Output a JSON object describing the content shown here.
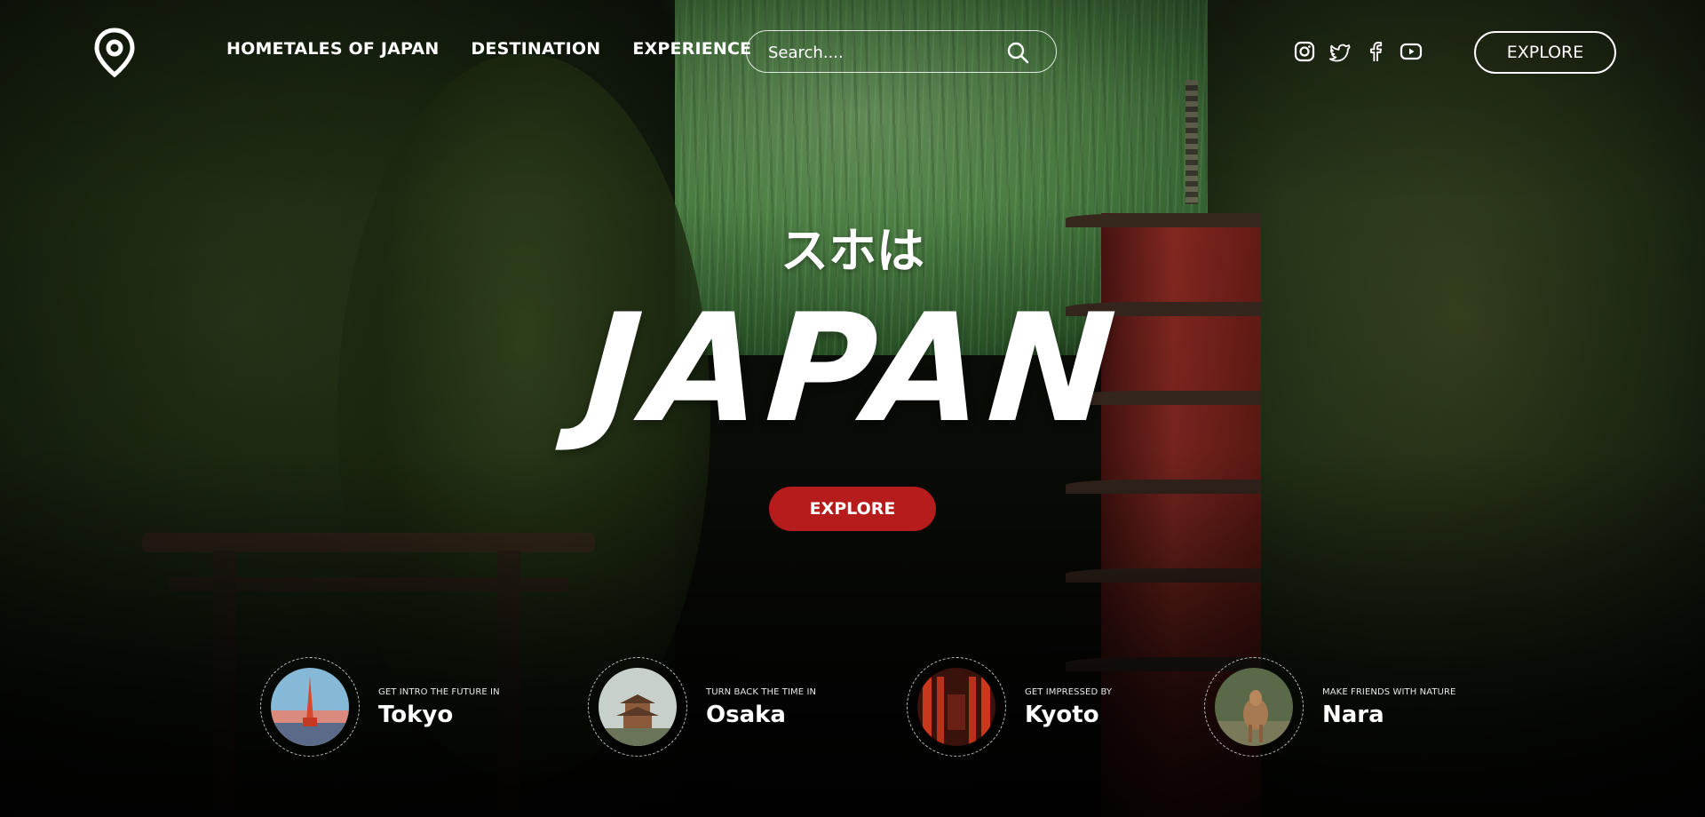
{
  "header": {
    "nav": [
      "HOMETALES OF JAPAN",
      "DESTINATION",
      "EXPERIENCE"
    ],
    "search_placeholder": "Search....",
    "socials": [
      "instagram-icon",
      "twitter-icon",
      "facebook-icon",
      "youtube-icon"
    ],
    "explore_label": "EXPLORE"
  },
  "hero": {
    "kana": "スホは",
    "title": "JAPAN",
    "explore_label": "EXPLORE"
  },
  "destinations": [
    {
      "subtitle": "GET INTRO THE FUTURE IN",
      "city": "Tokyo"
    },
    {
      "subtitle": "TURN BACK THE TIME IN",
      "city": "Osaka"
    },
    {
      "subtitle": "GET IMPRESSED BY",
      "city": "Kyoto"
    },
    {
      "subtitle": "MAKE FRIENDS WITH NATURE",
      "city": "Nara"
    }
  ],
  "colors": {
    "accent": "#b71c1c",
    "text": "#ffffff"
  }
}
